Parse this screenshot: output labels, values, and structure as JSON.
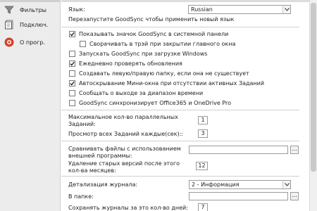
{
  "sidebar": {
    "items": [
      {
        "label": "Фильтры",
        "icon": "funnel-icon"
      },
      {
        "label": "Подключ.",
        "icon": "document-icon"
      },
      {
        "label": "О прогр.",
        "icon": "info-icon"
      }
    ]
  },
  "language": {
    "label": "Язык:",
    "value": "Russian",
    "hint": "Перезапустите GoodSync чтобы применить новый язык"
  },
  "options": [
    {
      "label": "Показывать значок GoodSync в системной панели",
      "checked": true
    },
    {
      "label": "Сворачивать в трэй при закрытии главного окна",
      "checked": false
    },
    {
      "label": "Запускать GoodSync при загрузке Windows",
      "checked": false
    },
    {
      "label": "Ежедневно проверять обновления",
      "checked": true
    },
    {
      "label": "Создавать левую/правую папку, если она не существует",
      "checked": false
    },
    {
      "label": "Автоскрывание Мини-окна при отсутствии активных Заданий",
      "checked": true
    },
    {
      "label": "Сообщать о выходе за диапазон времени",
      "checked": false
    },
    {
      "label": "GoodSync синхронизирует Office365 и OneDrive Pro",
      "checked": false
    }
  ],
  "jobs": {
    "max_parallel_label_1": "Максимальное кол-во параллельных",
    "max_parallel_label_2": "Заданий:",
    "max_parallel_value": "1",
    "scan_label": "Просмотр всех Заданий каждые(сек)::",
    "scan_value": "3"
  },
  "compare": {
    "label_1": "Сравнивать файлы с использованием",
    "label_2": "внешней программы:",
    "value": "",
    "browse": "..."
  },
  "versions": {
    "label_1": "Удаление старых версий после этого",
    "label_2": "кол-ва месяцев:",
    "value": "12"
  },
  "log": {
    "detail_label": "Детализация журнала:",
    "detail_value": "2 - Информация",
    "folder_label": "В папке:",
    "folder_value": "",
    "browse": "...",
    "keep_label": "Сохранять журналы за это кол-во дней:",
    "keep_value": "7"
  },
  "colors": {
    "check": "#1a1a1a",
    "funnel": "#6a6a6a",
    "info": "#d9381e"
  }
}
